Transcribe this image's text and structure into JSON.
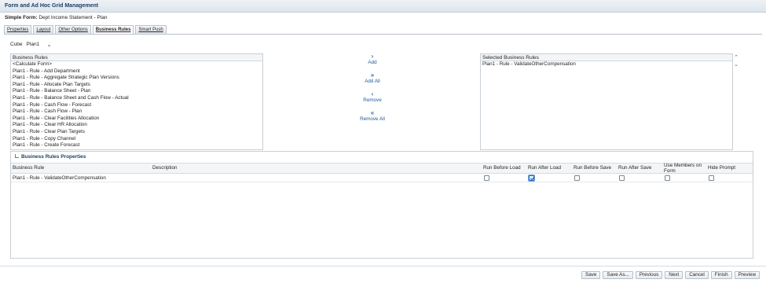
{
  "window": {
    "title": "Form and Ad Hoc Grid Management"
  },
  "form": {
    "label": "Simple Form:",
    "name": "Dept Income Statement - Plan"
  },
  "tabs": [
    {
      "label": "Properties",
      "active": false
    },
    {
      "label": "Layout",
      "active": false
    },
    {
      "label": "Other Options",
      "active": false
    },
    {
      "label": "Business Rules",
      "active": true
    },
    {
      "label": "Smart Push",
      "active": false
    }
  ],
  "cube": {
    "label": "Cube",
    "value": "Plan1"
  },
  "available_rules": {
    "header": "Business Rules",
    "items": [
      "<Calculate Form>",
      "Plan1 - Rule - Add Department",
      "Plan1 - Rule - Aggregate Strategic Plan Versions",
      "Plan1 - Rule - Allocate Plan Targets",
      "Plan1 - Rule - Balance Sheet - Plan",
      "Plan1 - Rule - Balance Sheet and Cash Flow - Actual",
      "Plan1 - Rule - Cash Flow - Forecast",
      "Plan1 - Rule - Cash Flow - Plan",
      "Plan1 - Rule - Clear Facilities Allocation",
      "Plan1 - Rule - Clear HR Allocation",
      "Plan1 - Rule - Clear Plan Targets",
      "Plan1 - Rule - Copy Channel",
      "Plan1 - Rule - Create Forecast"
    ]
  },
  "shuttle": {
    "add": "Add",
    "add_all": "Add All",
    "remove": "Remove",
    "remove_all": "Remove All"
  },
  "selected_rules": {
    "header": "Selected Business Rules",
    "items": [
      "Plan1 - Rule - ValidateOtherCompensation"
    ]
  },
  "properties": {
    "title": "Business Rules Properties",
    "columns": {
      "rule": "Business Rule",
      "description": "Description",
      "run_before_load": "Run Before Load",
      "run_after_load": "Run After Load",
      "run_before_save": "Run Before Save",
      "run_after_save": "Run After Save",
      "use_members_on_form": "Use Members on Form",
      "hide_prompt": "Hide Prompt"
    },
    "rows": [
      {
        "rule": "Plan1 - Rule - ValidateOtherCompensation",
        "description": "",
        "run_before_load": false,
        "run_after_load": true,
        "run_before_save": false,
        "run_after_save": false,
        "use_members_on_form": false,
        "hide_prompt": false
      }
    ]
  },
  "footer": {
    "save": "Save",
    "save_as": "Save As...",
    "previous": "Previous",
    "next": "Next",
    "cancel": "Cancel",
    "finish": "Finish",
    "preview": "Preview"
  }
}
